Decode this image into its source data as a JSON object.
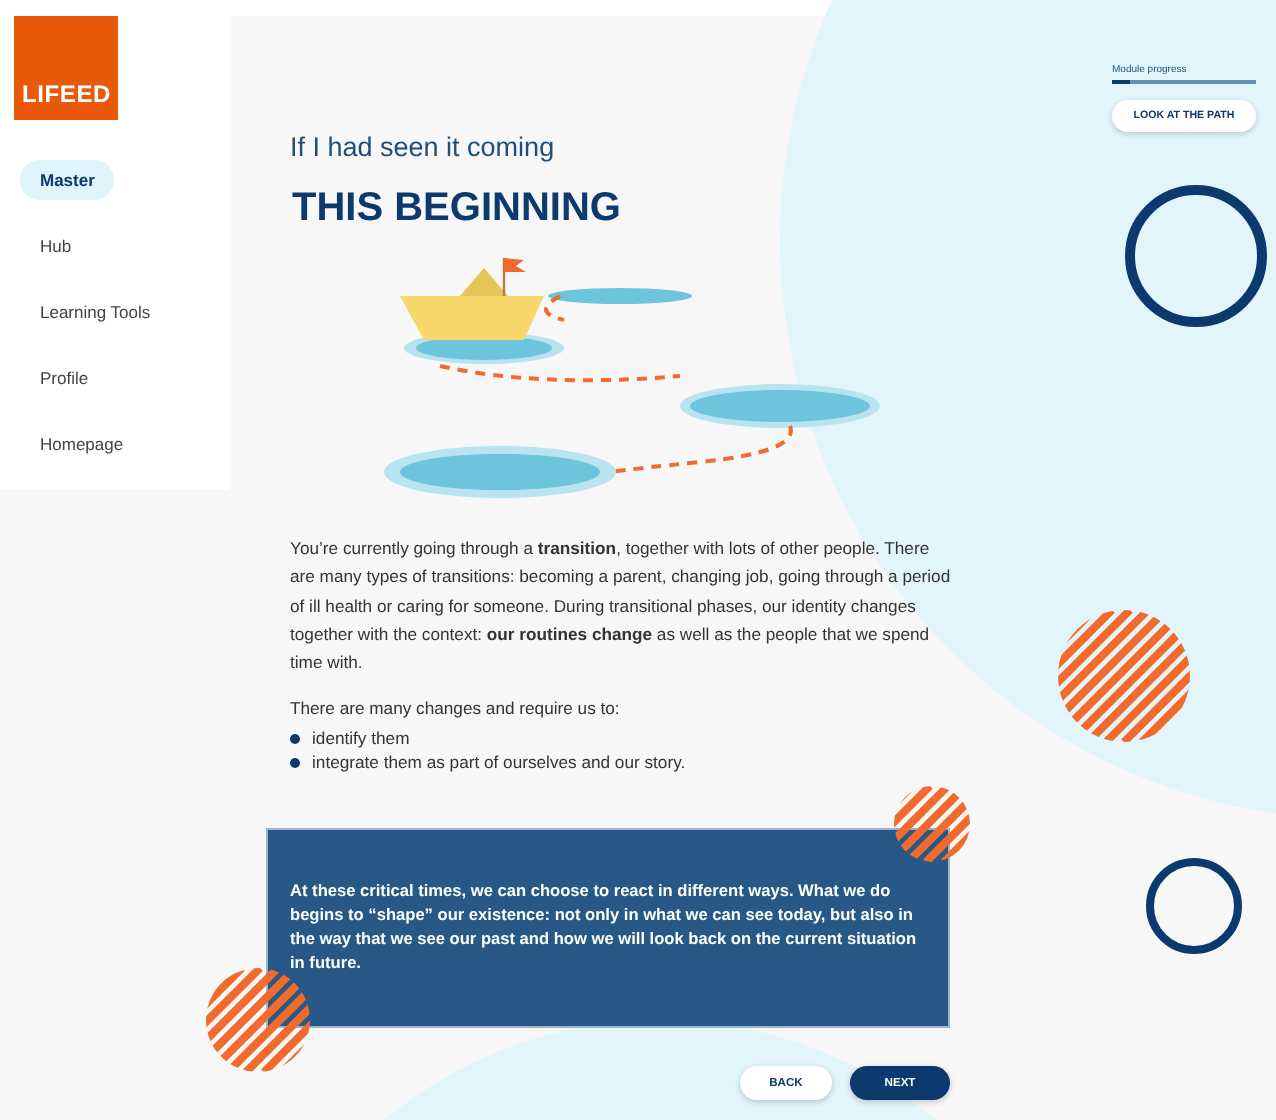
{
  "logo": {
    "text": "LIFEED"
  },
  "sidebar": {
    "items": [
      {
        "label": "Master",
        "selected": true
      },
      {
        "label": "Hub",
        "selected": false
      },
      {
        "label": "Learning Tools",
        "selected": false
      },
      {
        "label": "Profile",
        "selected": false
      },
      {
        "label": "Homepage",
        "selected": false
      }
    ]
  },
  "progress": {
    "label": "Module progress",
    "level": 0.12,
    "button": "LOOK AT THE PATH"
  },
  "heading": "If I had seen it coming",
  "title": "THIS BEGINNING",
  "paragraph": "You’re currently going through a **transition**, together with lots of other people. There are many types of transitions: becoming a parent, changing job, going through a period of ill health or caring for someone. During transitional phases, our identity changes together with the context: **our routines change** as well as the people that we spend time with.",
  "list_intro": "There are many changes and require us to:",
  "list_items": [
    "identify them",
    "integrate them as part of ourselves and our story."
  ],
  "callout": "At these critical times, we can choose to react in different ways. What we do begins to “shape” our existence: not only in what we can see today, but also in the way that we see our past and how we will look back on the current situation in future.",
  "buttons": [
    {
      "label": "BACK",
      "kind": "secondary"
    },
    {
      "label": "NEXT",
      "kind": "primary"
    }
  ]
}
